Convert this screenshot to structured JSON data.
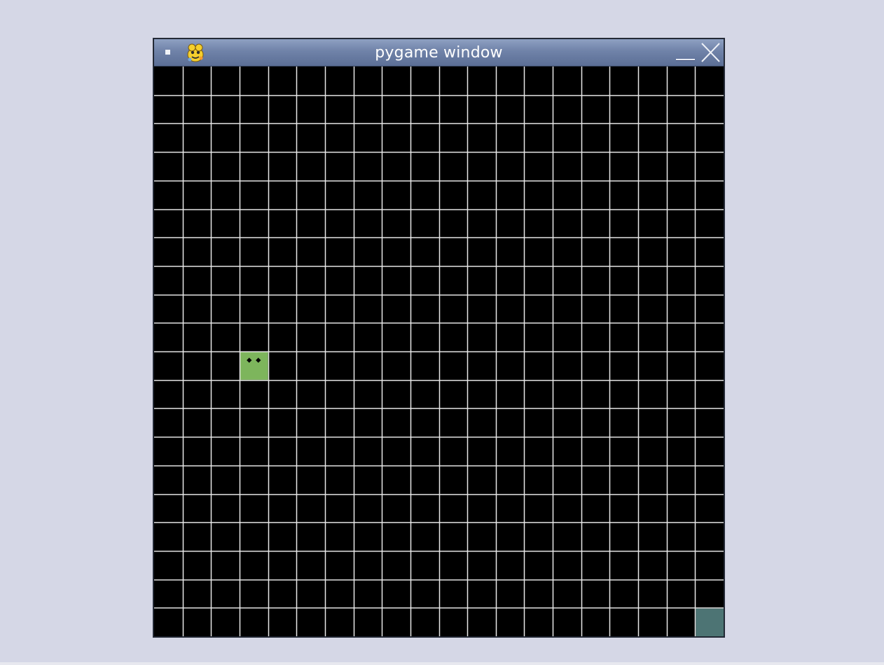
{
  "window": {
    "title": "pygame window"
  },
  "icons": {
    "menu": "window-menu-icon",
    "app": "pygame-snake-icon",
    "minimize": "minimize-icon",
    "close": "close-icon"
  },
  "game": {
    "columns": 20,
    "rows": 20,
    "snake_head": {
      "col": 3,
      "row": 10
    },
    "food": {
      "col": 19,
      "row": 19
    },
    "colors": {
      "background": "#000000",
      "grid_line": "#e8e8e8",
      "snake": "#7db55c",
      "snake_eye": "#000000",
      "food": "#4d7474"
    }
  }
}
